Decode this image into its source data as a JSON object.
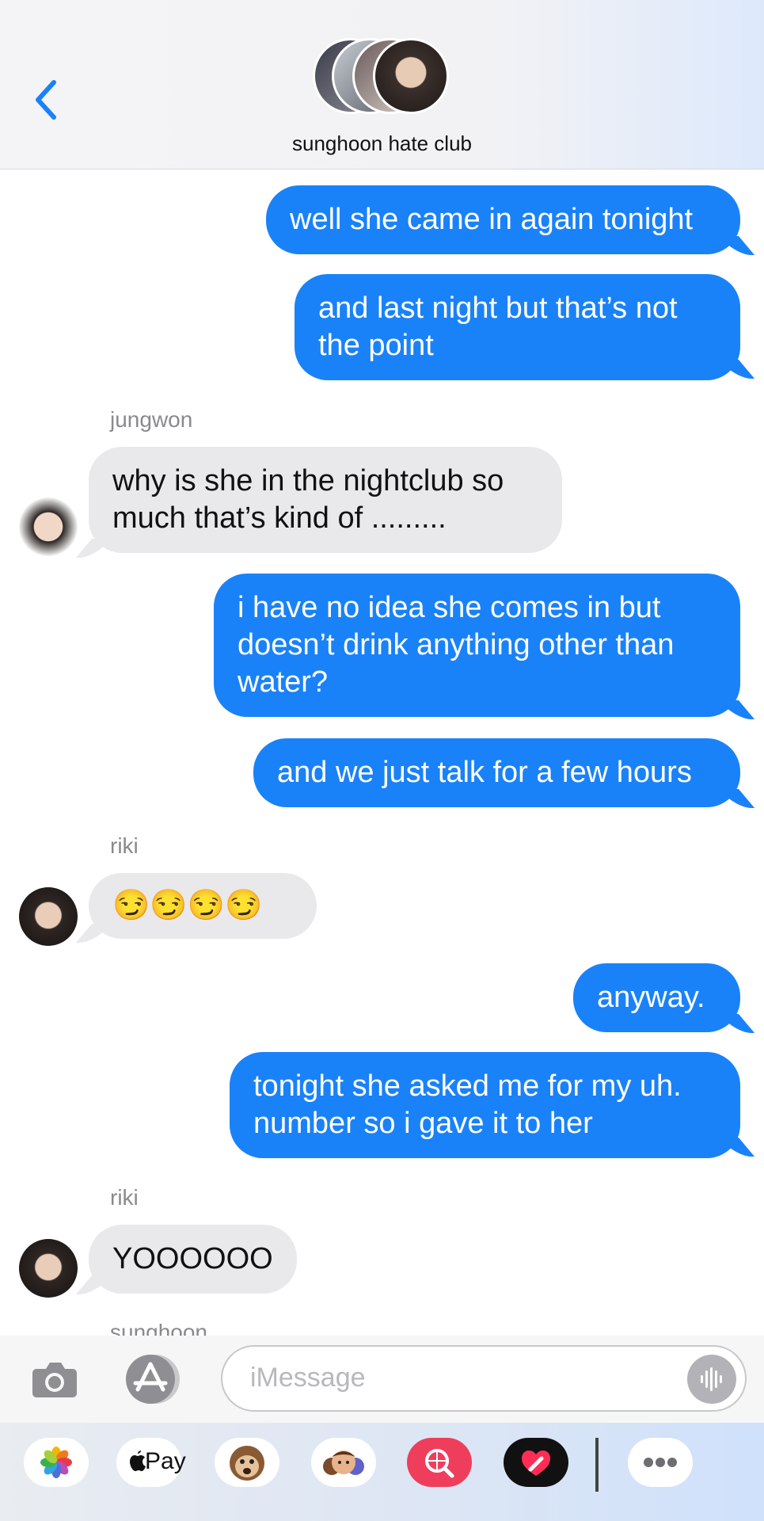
{
  "header": {
    "group_name": "sunghoon hate club"
  },
  "messages": {
    "m1": "well she came in again tonight",
    "m2": "and last night but that’s not the point",
    "jungwon_sender": "jungwon",
    "m3": "why is she in the nightclub so much that’s kind of .........",
    "m4": "i have no idea she comes in but doesn’t drink anything other than water?",
    "m5": "and we just talk for a few hours",
    "riki_sender_1": "riki",
    "m6": "😏😏😏😏",
    "m7": "anyway.",
    "m8": "tonight she asked me for my uh. number so i gave it to her",
    "riki_sender_2": "riki",
    "m9": "YOOOOOO",
    "sunghoon_sender": "sunghoon"
  },
  "input": {
    "placeholder": "iMessage"
  },
  "tray": {
    "apple_pay_label": "Pay",
    "apple_logo": ""
  },
  "icons": {
    "back": "chevron-left-icon",
    "camera": "camera-icon",
    "apps": "app-store-icon",
    "mic": "audio-waveform-icon",
    "photos": "photos-icon",
    "animoji": "monkey-animoji-icon",
    "memoji": "memoji-stickers-icon",
    "search": "web-search-icon",
    "digital_touch": "heart-icon",
    "more": "more-icon"
  },
  "colors": {
    "accent": "#1a82f8",
    "incoming_bubble": "#e9e9eb"
  }
}
